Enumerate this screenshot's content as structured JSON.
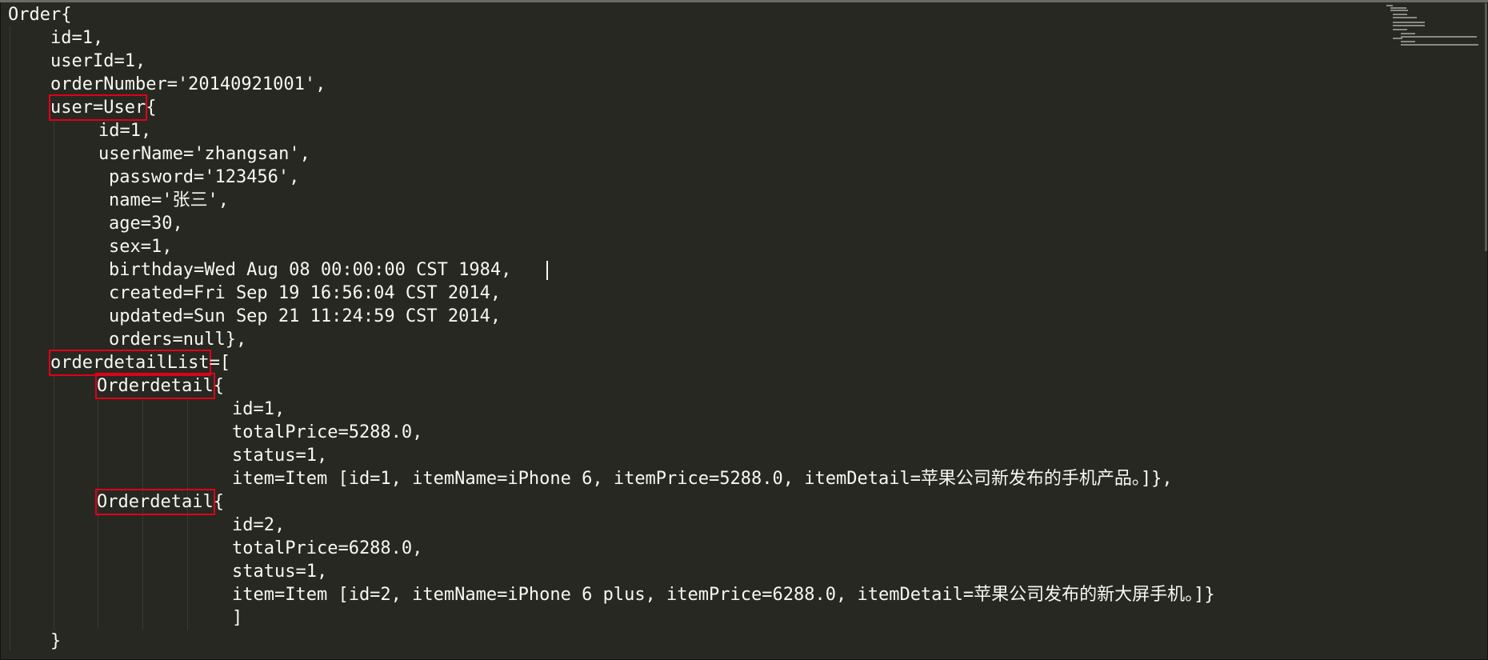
{
  "editor": {
    "theme_colors": {
      "background": "#272822",
      "text": "#f8f8f2",
      "highlight_box": "#e0001a"
    },
    "lines": [
      {
        "text": "Order{"
      },
      {
        "text": "id=1,"
      },
      {
        "text": "userId=1,"
      },
      {
        "text": "orderNumber='20140921001',"
      },
      {
        "boxed": "user=User",
        "text": "{"
      },
      {
        "text": "id=1,"
      },
      {
        "text": "userName='zhangsan',"
      },
      {
        "text": "password='123456',"
      },
      {
        "text": "name='张三',"
      },
      {
        "text": "age=30,"
      },
      {
        "text": "sex=1,"
      },
      {
        "text": "birthday=Wed Aug 08 00:00:00 CST 1984,"
      },
      {
        "text": "created=Fri Sep 19 16:56:04 CST 2014,"
      },
      {
        "text": "updated=Sun Sep 21 11:24:59 CST 2014,"
      },
      {
        "text": "orders=null},"
      },
      {
        "boxed": "orderdetailList",
        "text": "=["
      },
      {
        "boxed": "Orderdetail",
        "text": "{"
      },
      {
        "text": "id=1,"
      },
      {
        "text": "totalPrice=5288.0,"
      },
      {
        "text": "status=1,"
      },
      {
        "text": "item=Item [id=1, itemName=iPhone 6, itemPrice=5288.0, itemDetail=苹果公司新发布的手机产品。]},"
      },
      {
        "boxed": "Orderdetail",
        "text": "{"
      },
      {
        "text": "id=2,"
      },
      {
        "text": "totalPrice=6288.0,"
      },
      {
        "text": "status=1,"
      },
      {
        "text": "item=Item [id=2, itemName=iPhone 6 plus, itemPrice=6288.0, itemDetail=苹果公司发布的新大屏手机。]}"
      },
      {
        "text": "]"
      },
      {
        "text": "}"
      }
    ]
  }
}
